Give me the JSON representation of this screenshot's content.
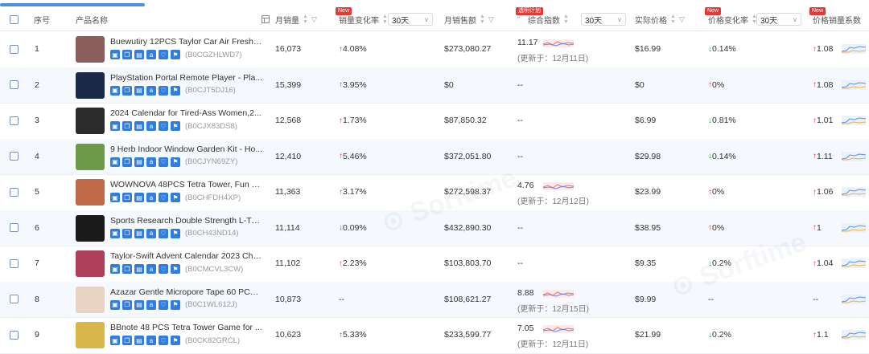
{
  "header": {
    "seq": "序号",
    "product_name": "产品名称",
    "monthly_sales": "月销量",
    "sales_change": "销量变化率",
    "period_a": "30天",
    "monthly_revenue": "月销售额",
    "badge_plan": "透明计划",
    "combo_index": "综合指数",
    "period_b": "30天",
    "actual_price": "实际价格",
    "price_change": "价格变化率",
    "period_c": "30天",
    "price_sales_coef": "价格销量系数",
    "new_badge": "New"
  },
  "rows": [
    {
      "seq": "1",
      "name": "Buewutiry 12PCS Taylor Car Air Freshe...",
      "asin": "(B0CGZHLWD7)",
      "sales": "16,073",
      "sales_change": "4.08%",
      "sales_dir": "up",
      "revenue": "$273,080.27",
      "index": "11.17",
      "updated": "(更新于：12月11日)",
      "price": "$16.99",
      "price_change": "0.14%",
      "price_dir": "down",
      "coef": "1.08",
      "coef_dir": "up",
      "thumb": "#8b5e5e"
    },
    {
      "seq": "2",
      "name": "PlayStation Portal Remote Player - Pla...",
      "asin": "(B0CJT5DJ16)",
      "sales": "15,399",
      "sales_change": "3.95%",
      "sales_dir": "up",
      "revenue": "$0",
      "index": "--",
      "updated": "",
      "price": "$0",
      "price_change": "0%",
      "price_dir": "up",
      "coef": "1.08",
      "coef_dir": "up",
      "thumb": "#1c2a4a"
    },
    {
      "seq": "3",
      "name": "2024 Calendar for Tired-Ass Women,2...",
      "asin": "(B0CJX83DS8)",
      "sales": "12,568",
      "sales_change": "1.73%",
      "sales_dir": "up",
      "revenue": "$87,850.32",
      "index": "--",
      "updated": "",
      "price": "$6.99",
      "price_change": "0.81%",
      "price_dir": "down",
      "coef": "1.01",
      "coef_dir": "up",
      "thumb": "#2b2b2b"
    },
    {
      "seq": "4",
      "name": "9 Herb Indoor Window Garden Kit - Ho...",
      "asin": "(B0CJYN69ZY)",
      "sales": "12,410",
      "sales_change": "5.46%",
      "sales_dir": "up",
      "revenue": "$372,051.80",
      "index": "--",
      "updated": "",
      "price": "$29.98",
      "price_change": "0.14%",
      "price_dir": "down",
      "coef": "1.11",
      "coef_dir": "up",
      "thumb": "#6f9a4a"
    },
    {
      "seq": "5",
      "name": "WOWNOVA 48PCS Tetra Tower, Fun B...",
      "asin": "(B0CHFDH4XP)",
      "sales": "11,363",
      "sales_change": "3.17%",
      "sales_dir": "up",
      "revenue": "$272,598.37",
      "index": "4.76",
      "updated": "(更新于：12月12日)",
      "price": "$23.99",
      "price_change": "0%",
      "price_dir": "up",
      "coef": "1.06",
      "coef_dir": "up",
      "thumb": "#c06a4a"
    },
    {
      "seq": "6",
      "name": "Sports Research Double Strength L-Th...",
      "asin": "(B0CH43ND14)",
      "sales": "11,114",
      "sales_change": "0.09%",
      "sales_dir": "down",
      "revenue": "$432,890.30",
      "index": "--",
      "updated": "",
      "price": "$38.95",
      "price_change": "0%",
      "price_dir": "up",
      "coef": "1",
      "coef_dir": "up",
      "thumb": "#1a1a1a"
    },
    {
      "seq": "7",
      "name": "Taylor-Swift Advent Calendar 2023 Chri...",
      "asin": "(B0CMCVL3CW)",
      "sales": "11,102",
      "sales_change": "2.23%",
      "sales_dir": "up",
      "revenue": "$103,803.70",
      "index": "--",
      "updated": "",
      "price": "$9.35",
      "price_change": "0.2%",
      "price_dir": "down",
      "coef": "1.04",
      "coef_dir": "up",
      "thumb": "#b0405a"
    },
    {
      "seq": "8",
      "name": "Azazar Gentle Micropore Tape 60 PCS ...",
      "asin": "(B0C1WL612J)",
      "sales": "10,873",
      "sales_change": "--",
      "sales_dir": "none",
      "revenue": "$108,621.27",
      "index": "8.88",
      "updated": "(更新于：12月15日)",
      "price": "$9.99",
      "price_change": "--",
      "price_dir": "none",
      "coef": "--",
      "coef_dir": "none",
      "thumb": "#e8d2c2"
    },
    {
      "seq": "9",
      "name": "BBnote 48 PCS Tetra Tower Game for ...",
      "asin": "(B0CK82GRCL)",
      "sales": "10,623",
      "sales_change": "5.33%",
      "sales_dir": "up",
      "revenue": "$233,599.77",
      "index": "7.05",
      "updated": "(更新于：12月11日)",
      "price": "$21.99",
      "price_change": "0.2%",
      "price_dir": "down",
      "coef": "1.1",
      "coef_dir": "up",
      "thumb": "#d9b64a"
    }
  ],
  "icons": [
    "chart-icon",
    "copy-icon",
    "doc-icon",
    "amazon-icon",
    "heart-icon",
    "flag-icon"
  ],
  "colors": {
    "accent": "#2f7de1",
    "up": "#e53935",
    "down": "#2e9e3e",
    "badge": "#e53935"
  }
}
